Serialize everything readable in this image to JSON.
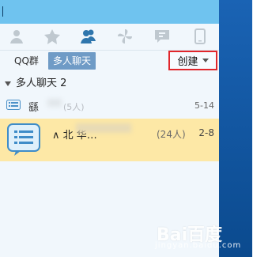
{
  "colors": {
    "titlebar": "#6fc3ef",
    "accent_tab": "#2f76ad",
    "selected_row": "#fde8a6",
    "create_outline": "#e1262b"
  },
  "tabs": [
    {
      "name": "contacts-tab",
      "icon": "person-icon"
    },
    {
      "name": "favorites-tab",
      "icon": "star-icon"
    },
    {
      "name": "group-chat-tab",
      "icon": "people-icon",
      "active": true
    },
    {
      "name": "apps-tab",
      "icon": "pinwheel-icon"
    },
    {
      "name": "messages-tab",
      "icon": "chat-bubble-icon"
    },
    {
      "name": "phone-tab",
      "icon": "phone-icon"
    }
  ],
  "subtabs": {
    "qq_group": "QQ群",
    "multi_chat": "多人聊天",
    "create": "创建"
  },
  "group": {
    "title": "多人聊天 2"
  },
  "rows": [
    {
      "name": "繇",
      "count": "(5人)",
      "date": "5-14"
    },
    {
      "name": "∧ 北    华…",
      "count": "(24人)",
      "date": "2-8"
    }
  ],
  "watermark": {
    "text": "Bai百度",
    "sub": "jingyan.baidu.com"
  }
}
